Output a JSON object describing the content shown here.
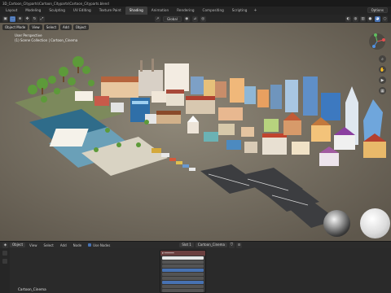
{
  "window": {
    "title": "3D_Cartoon_Cityparts\\Cartoon_Cityparts\\Cartoon_Cityparts.blend"
  },
  "workspaces": {
    "tabs": [
      {
        "label": "Layout",
        "active": false
      },
      {
        "label": "Modeling",
        "active": false
      },
      {
        "label": "Sculpting",
        "active": false
      },
      {
        "label": "UV Editing",
        "active": false
      },
      {
        "label": "Texture Paint",
        "active": false
      },
      {
        "label": "Shading",
        "active": true
      },
      {
        "label": "Animation",
        "active": false
      },
      {
        "label": "Rendering",
        "active": false
      },
      {
        "label": "Compositing",
        "active": false
      },
      {
        "label": "Scripting",
        "active": false
      }
    ],
    "add": "+"
  },
  "header_right": {
    "scene_label": "Options"
  },
  "toolbar": {
    "transform_orientation": "Global"
  },
  "viewport": {
    "mode": "Object Mode",
    "menus": [
      "View",
      "Select",
      "Add",
      "Object"
    ],
    "overlay_line1": "User Perspective",
    "overlay_line2": "(1) Scene Collection | Cartoon_Cinema",
    "background_color": "#7b7468"
  },
  "bottom_editor": {
    "editor_type": "Object",
    "menus": [
      "View",
      "Select",
      "Add",
      "Node"
    ],
    "use_nodes_label": "Use Nodes",
    "slot": "Slot 1",
    "material": "Cartoon_Cinema",
    "object_name": "Cartoon_Cinema"
  },
  "colors": {
    "accent": "#4772b3",
    "node_header": "#6b3f3f"
  }
}
